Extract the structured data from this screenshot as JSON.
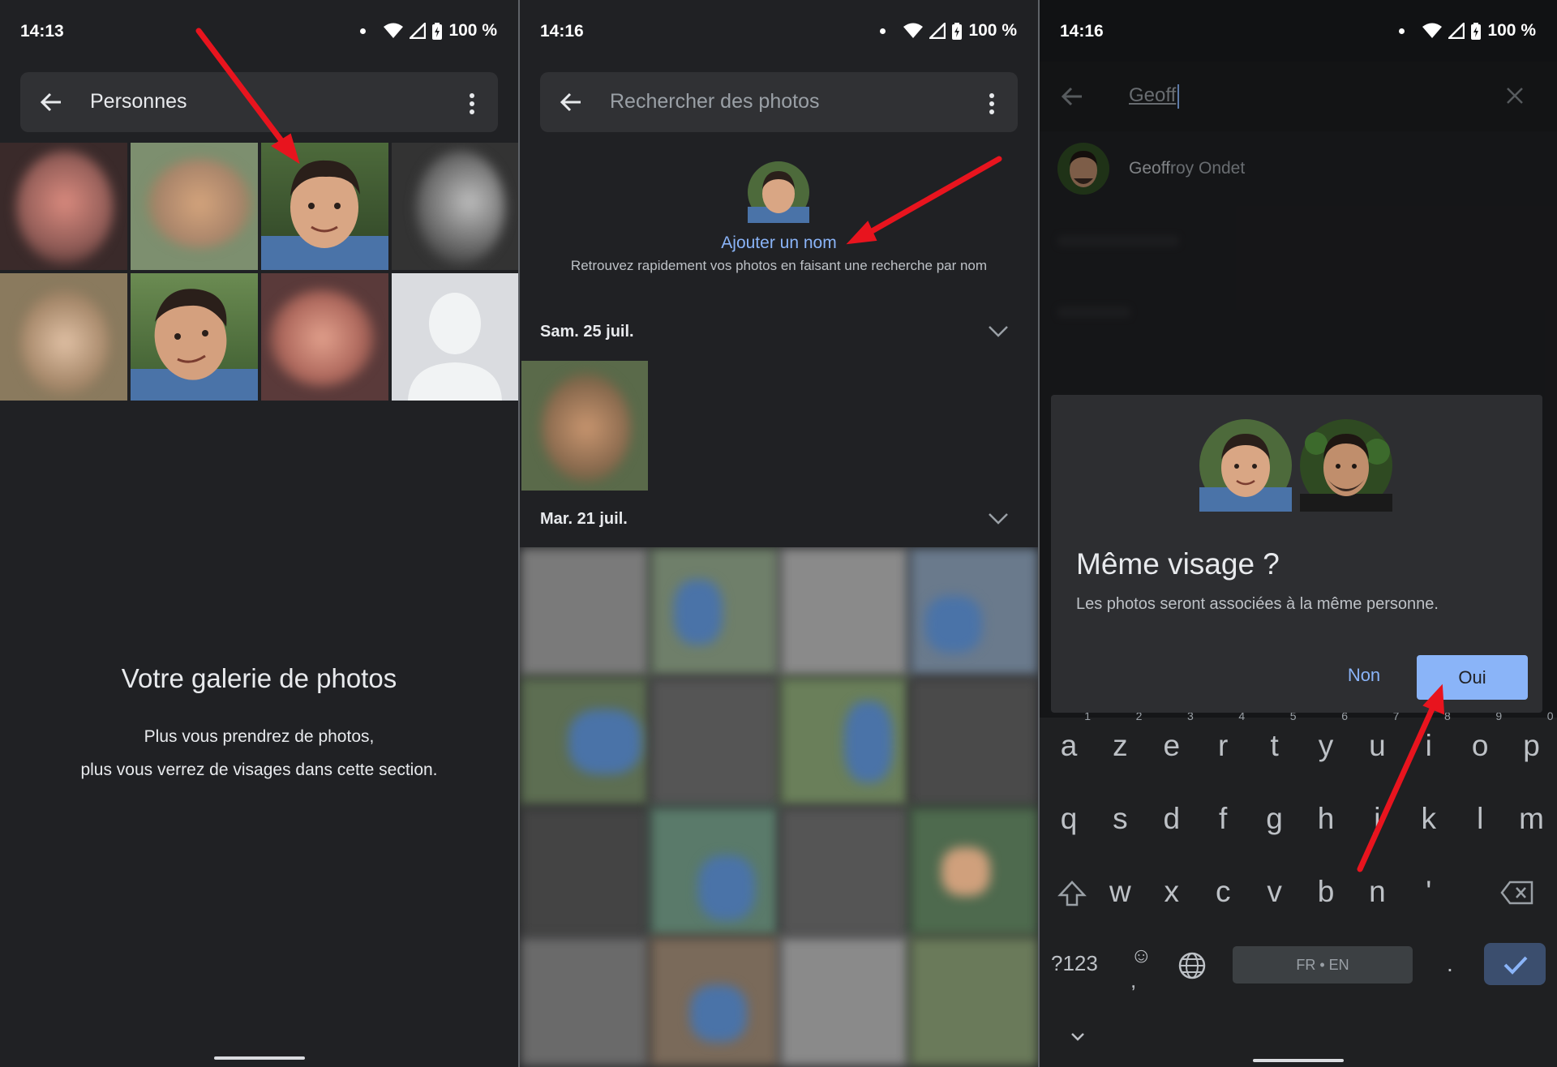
{
  "panel1": {
    "time": "14:13",
    "battery": "100 %",
    "title": "Personnes",
    "empty_title": "Votre galerie de photos",
    "empty_line1": "Plus vous prendrez de photos,",
    "empty_line2": "plus vous verrez de visages dans cette section."
  },
  "panel2": {
    "time": "14:16",
    "battery": "100 %",
    "search_placeholder": "Rechercher des photos",
    "add_name": "Ajouter un nom",
    "add_name_hint": "Retrouvez rapidement vos photos en faisant une recherche par nom",
    "date1": "Sam. 25 juil.",
    "date2": "Mar. 21 juil."
  },
  "panel3": {
    "time": "14:16",
    "battery": "100 %",
    "query": "Geoff",
    "suggestion_prefix": "Geoff",
    "suggestion_rest": "roy Ondet",
    "dialog_title": "Même visage ?",
    "dialog_text": "Les photos seront associées à la même personne.",
    "no_label": "Non",
    "yes_label": "Oui",
    "keyboard": {
      "row1": [
        "a",
        "z",
        "e",
        "r",
        "t",
        "y",
        "u",
        "i",
        "o",
        "p"
      ],
      "row1_hints": [
        "1",
        "2",
        "3",
        "4",
        "5",
        "6",
        "7",
        "8",
        "9",
        "0"
      ],
      "row2": [
        "q",
        "s",
        "d",
        "f",
        "g",
        "h",
        "j",
        "k",
        "l",
        "m"
      ],
      "row3": [
        "w",
        "x",
        "c",
        "v",
        "b",
        "n",
        "'"
      ],
      "numbers_key": "?123",
      "space_label": "FR • EN",
      "period": "."
    }
  },
  "colors": {
    "background": "#202124",
    "accent": "#8ab4f8",
    "arrow": "#e8141e"
  }
}
